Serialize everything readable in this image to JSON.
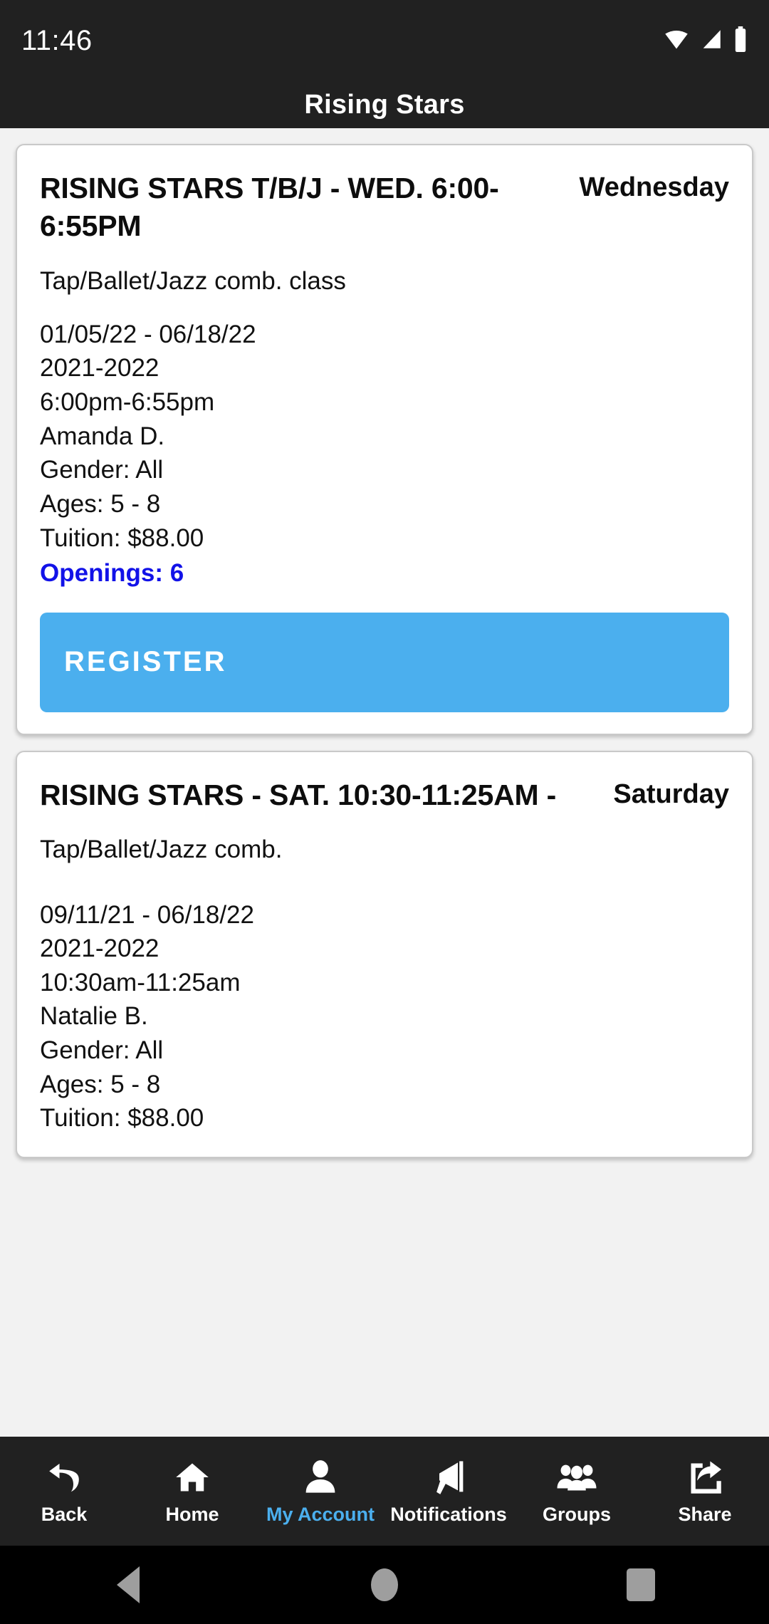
{
  "status_bar": {
    "time": "11:46",
    "icons": [
      "wifi-icon",
      "cellular-signal-icon",
      "battery-icon"
    ]
  },
  "header": {
    "title": "Rising Stars"
  },
  "theme": {
    "accent": "#4BAFEE",
    "openings_color": "#1212E8",
    "bar_background": "#212121"
  },
  "classes": [
    {
      "title": "RISING STARS T/B/J - WED. 6:00-6:55PM",
      "day": "Wednesday",
      "description": "Tap/Ballet/Jazz comb. class",
      "details": [
        "01/05/22 - 06/18/22",
        "2021-2022",
        "6:00pm-6:55pm",
        "Amanda D.",
        "Gender: All",
        "Ages: 5 - 8",
        "Tuition: $88.00"
      ],
      "openings": "Openings: 6",
      "register_label": "REGISTER"
    },
    {
      "title": "RISING STARS - SAT. 10:30-11:25AM -",
      "day": "Saturday",
      "description": "Tap/Ballet/Jazz comb.",
      "details": [
        "09/11/21 - 06/18/22",
        "2021-2022",
        "10:30am-11:25am",
        "Natalie B.",
        "Gender: All",
        "Ages: 5 - 8",
        "Tuition: $88.00"
      ]
    }
  ],
  "bottom_nav": {
    "items": [
      {
        "label": "Back",
        "icon": "undo-arrow-icon",
        "active": false
      },
      {
        "label": "Home",
        "icon": "home-icon",
        "active": false
      },
      {
        "label": "My Account",
        "icon": "person-icon",
        "active": true
      },
      {
        "label": "Notifications",
        "icon": "megaphone-icon",
        "active": false
      },
      {
        "label": "Groups",
        "icon": "people-group-icon",
        "active": false
      },
      {
        "label": "Share",
        "icon": "share-icon",
        "active": false
      }
    ]
  },
  "system_nav": {
    "buttons": [
      "android-back-icon",
      "android-home-icon",
      "android-recents-icon"
    ]
  }
}
